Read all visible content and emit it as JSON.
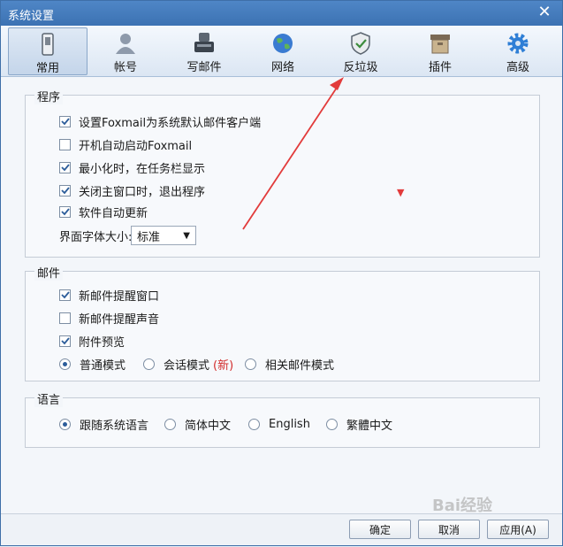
{
  "window": {
    "title": "系统设置"
  },
  "tabs": [
    {
      "label": "常用",
      "icon": "phone-icon"
    },
    {
      "label": "帐号",
      "icon": "user-icon"
    },
    {
      "label": "写邮件",
      "icon": "compose-icon"
    },
    {
      "label": "网络",
      "icon": "globe-icon"
    },
    {
      "label": "反垃圾",
      "icon": "shield-icon"
    },
    {
      "label": "插件",
      "icon": "box-icon"
    },
    {
      "label": "高级",
      "icon": "gear-icon"
    }
  ],
  "program": {
    "title": "程序",
    "options": [
      {
        "label": "设置Foxmail为系统默认邮件客户端",
        "checked": true
      },
      {
        "label": "开机自动启动Foxmail",
        "checked": false
      },
      {
        "label": "最小化时，在任务栏显示",
        "checked": true
      },
      {
        "label": "关闭主窗口时，退出程序",
        "checked": true
      },
      {
        "label": "软件自动更新",
        "checked": true
      }
    ],
    "font_size_label": "界面字体大小:",
    "font_size_value": "标准"
  },
  "mail": {
    "title": "邮件",
    "options": [
      {
        "label": "新邮件提醒窗口",
        "checked": true
      },
      {
        "label": "新邮件提醒声音",
        "checked": false
      },
      {
        "label": "附件预览",
        "checked": true
      }
    ],
    "modes": [
      {
        "label": "普通模式",
        "selected": true
      },
      {
        "label": "会话模式",
        "selected": false,
        "tag": "(新)"
      },
      {
        "label": "相关邮件模式",
        "selected": false
      }
    ]
  },
  "language": {
    "title": "语言",
    "options": [
      {
        "label": "跟随系统语言",
        "selected": true
      },
      {
        "label": "简体中文",
        "selected": false
      },
      {
        "label": "English",
        "selected": false
      },
      {
        "label": "繁體中文",
        "selected": false
      }
    ]
  },
  "buttons": {
    "ok": "确定",
    "cancel": "取消",
    "apply": "应用(A)"
  },
  "watermark": "Bai经验",
  "colors": {
    "accent": "#3c72b3",
    "annotation": "#e23b3b"
  }
}
